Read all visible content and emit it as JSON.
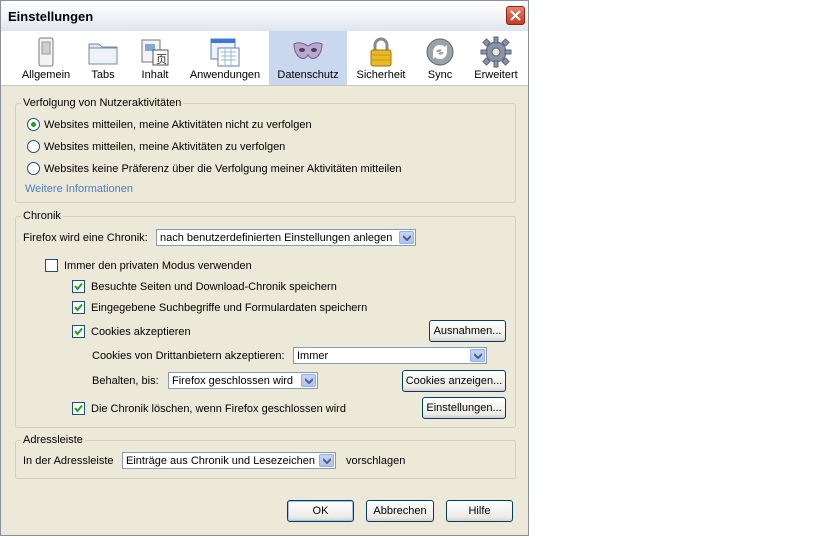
{
  "window": {
    "title": "Einstellungen"
  },
  "toolbar": {
    "items": [
      {
        "label": "Allgemein",
        "icon": "switch-icon"
      },
      {
        "label": "Tabs",
        "icon": "folder-tabs-icon"
      },
      {
        "label": "Inhalt",
        "icon": "content-icon"
      },
      {
        "label": "Anwendungen",
        "icon": "applications-icon"
      },
      {
        "label": "Datenschutz",
        "icon": "mask-icon",
        "selected": true
      },
      {
        "label": "Sicherheit",
        "icon": "padlock-icon"
      },
      {
        "label": "Sync",
        "icon": "sync-icon"
      },
      {
        "label": "Erweitert",
        "icon": "gear-icon"
      }
    ]
  },
  "tracking": {
    "legend": "Verfolgung von Nutzeraktivitäten",
    "options": [
      {
        "label": "Websites mitteilen, meine Aktivitäten nicht zu verfolgen",
        "selected": true
      },
      {
        "label": "Websites mitteilen, meine Aktivitäten zu verfolgen",
        "selected": false
      },
      {
        "label": "Websites keine Präferenz über die Verfolgung meiner Aktivitäten mitteilen",
        "selected": false
      }
    ],
    "more_info": "Weitere Informationen"
  },
  "history": {
    "legend": "Chronik",
    "mode_label": "Firefox wird eine Chronik:",
    "mode_value": "nach benutzerdefinierten Einstellungen anlegen",
    "private_mode": {
      "label": "Immer den privaten Modus verwenden",
      "checked": false
    },
    "visited": {
      "label": "Besuchte Seiten und Download-Chronik speichern",
      "checked": true
    },
    "search_forms": {
      "label": "Eingegebene Suchbegriffe und Formulardaten speichern",
      "checked": true
    },
    "cookies": {
      "label": "Cookies akzeptieren",
      "checked": true
    },
    "exceptions_button": "Ausnahmen...",
    "third_party_label": "Cookies von Drittanbietern akzeptieren:",
    "third_party_value": "Immer",
    "keep_label": "Behalten, bis:",
    "keep_value": "Firefox geschlossen wird",
    "show_cookies_button": "Cookies anzeigen...",
    "clear_on_close": {
      "label": "Die Chronik löschen, wenn Firefox geschlossen wird",
      "checked": true
    },
    "settings_button": "Einstellungen..."
  },
  "addressbar": {
    "legend": "Adressleiste",
    "prefix": "In der Adressleiste",
    "value": "Einträge aus Chronik und Lesezeichen",
    "suffix": "vorschlagen"
  },
  "buttons": {
    "ok": "OK",
    "cancel": "Abbrechen",
    "help": "Hilfe"
  }
}
